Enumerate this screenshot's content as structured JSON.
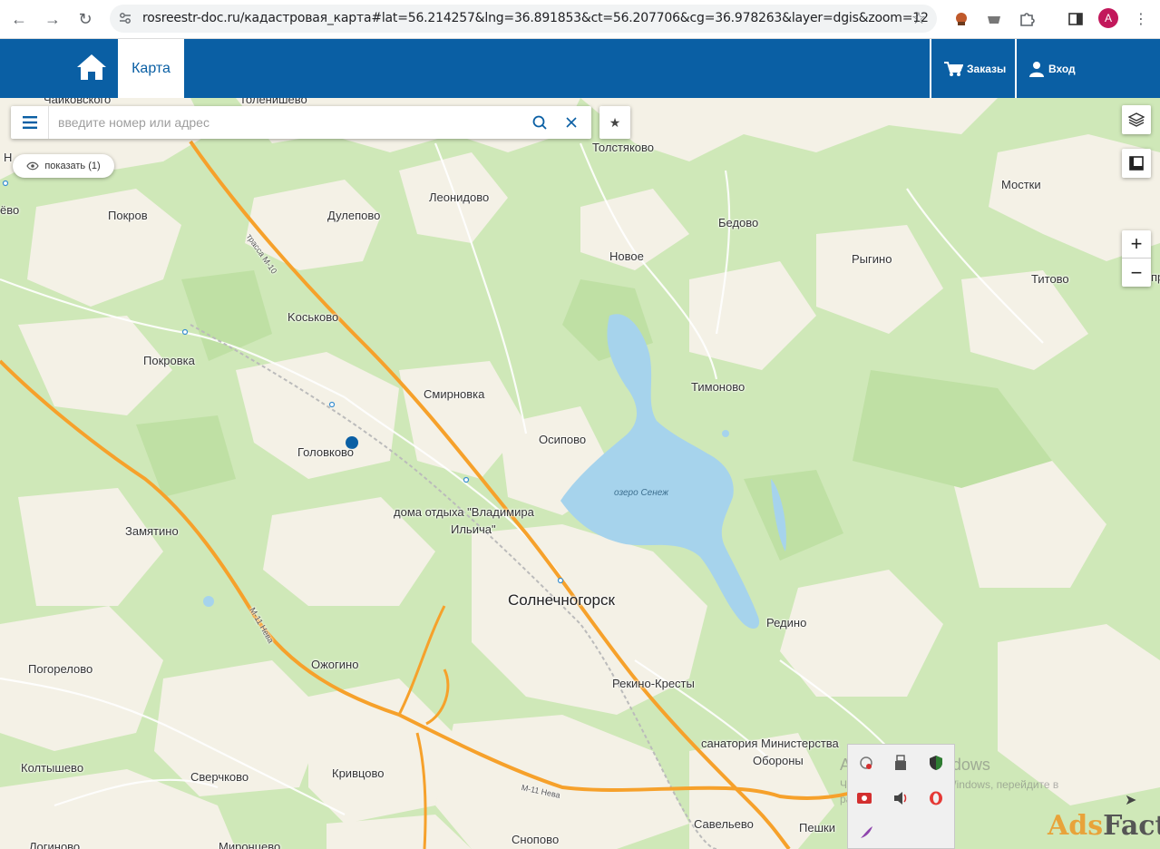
{
  "browser": {
    "url": "rosreestr-doc.ru/кадастровая_карта#lat=56.214257&lng=36.891853&ct=56.207706&cg=36.978263&layer=dgis&zoom=12",
    "profile_initial": "A"
  },
  "header": {
    "tab_label": "Карта",
    "orders_label": "Заказы",
    "login_label": "Вход",
    "bg_color": "#0a5fa4"
  },
  "search": {
    "placeholder": "введите номер или адрес",
    "show_label": "показать (1)"
  },
  "controls": {
    "zoom_in": "+",
    "zoom_out": "−"
  },
  "map": {
    "lake_name": "озеро Сенеж",
    "road_m10": "трасса М-10",
    "road_m11a": "М-11 Нева",
    "road_m11b": "М-11 Нева",
    "places": {
      "chaikovskogo": "Чайковского",
      "tolenishevo": "Толенишево",
      "tolstyakovo": "Толстяково",
      "mostki": "Мостки",
      "leonidovo": "Леонидово",
      "pokrov": "Покров",
      "dulepovo": "Дулепово",
      "bedovo": "Бедово",
      "novoe": "Новое",
      "rygino": "Рыгино",
      "titovo": "Титово",
      "koskovo": "Koськово",
      "pokrovka": "Покровка",
      "smirnovka": "Смирновка",
      "timonovo": "Тимоново",
      "golovkovo": "Головково",
      "osipovo": "Осипово",
      "doma_otdyha_1": "дома отдыха \"Владимира",
      "doma_otdyha_2": "Ильича\"",
      "zamyatino": "Замятино",
      "solnechnogorsk": "Солнечногорск",
      "redino": "Редино",
      "ozhogino": "Ожогино",
      "pogorelovo": "Погорелово",
      "rekino_kresty": "Рекино-Кресты",
      "sanatoriya": "санатория Министерства",
      "oborony": "Обороны",
      "koltyshevo": "Колтышево",
      "sverchkovo": "Сверчково",
      "krivtsovo": "Кривцово",
      "savelevo": "Савельево",
      "peshki": "Пешки",
      "snopovo": "Сноповo",
      "logino": "Логиново",
      "mironcevo": "Миронцево",
      "edge_n": "Н",
      "edge_evo": "ёво",
      "edge_pr": "пр"
    }
  },
  "overlay": {
    "activation_title": "Активация Windows",
    "activation_line1": "Чтобы активировать Windows, перейдите в",
    "activation_line2": "раздел \"Параметры\".",
    "watermark_1": "Ads",
    "watermark_2": "Factory"
  }
}
